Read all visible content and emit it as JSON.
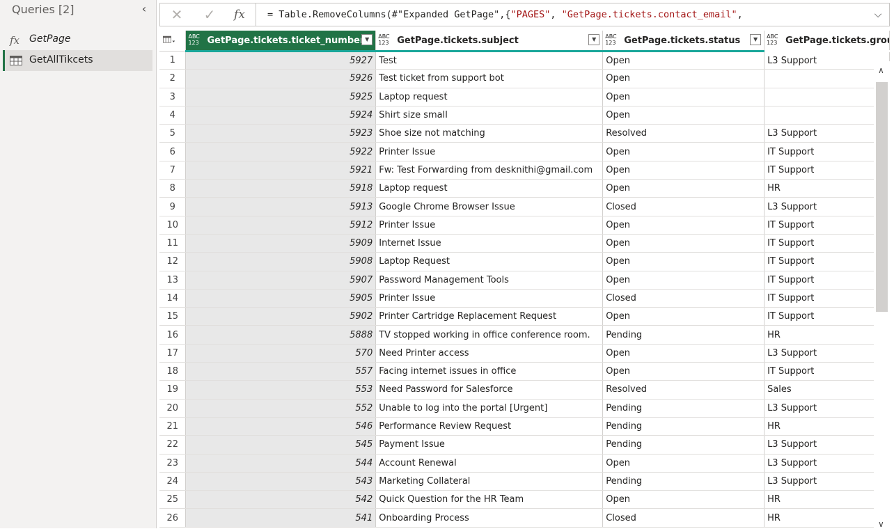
{
  "queries": {
    "title": "Queries [2]",
    "items": [
      {
        "label": "GetPage",
        "icon": "function-icon"
      },
      {
        "label": "GetAllTikcets",
        "icon": "table-icon"
      }
    ]
  },
  "formula_bar": {
    "prefix": "= Table.RemoveColumns(#\"Expanded GetPage\",{",
    "str1": "\"PAGES\"",
    "mid": ", ",
    "str2": "\"GetPage.tickets.contact_email\"",
    "suffix": ","
  },
  "columns": [
    {
      "label": "GetPage.tickets.ticket_number",
      "type": "ABC 123"
    },
    {
      "label": "GetPage.tickets.subject",
      "type": "ABC 123"
    },
    {
      "label": "GetPage.tickets.status",
      "type": "ABC 123"
    },
    {
      "label": "GetPage.tickets.group",
      "type": "ABC 123"
    }
  ],
  "rows": [
    [
      "1",
      "5927",
      "Test",
      "Open",
      "L3 Support"
    ],
    [
      "2",
      "5926",
      "Test ticket from support bot",
      "Open",
      ""
    ],
    [
      "3",
      "5925",
      "Laptop request",
      "Open",
      ""
    ],
    [
      "4",
      "5924",
      "Shirt size small",
      "Open",
      ""
    ],
    [
      "5",
      "5923",
      "Shoe size not matching",
      "Resolved",
      "L3 Support"
    ],
    [
      "6",
      "5922",
      "Printer Issue",
      "Open",
      "IT Support"
    ],
    [
      "7",
      "5921",
      "Fw: Test Forwarding from desknithi@gmail.com",
      "Open",
      "IT Support"
    ],
    [
      "8",
      "5918",
      "Laptop request",
      "Open",
      "HR"
    ],
    [
      "9",
      "5913",
      "Google Chrome Browser Issue",
      "Closed",
      "L3 Support"
    ],
    [
      "10",
      "5912",
      "Printer Issue",
      "Open",
      "IT Support"
    ],
    [
      "11",
      "5909",
      "Internet Issue",
      "Open",
      "IT Support"
    ],
    [
      "12",
      "5908",
      "Laptop Request",
      "Open",
      "IT Support"
    ],
    [
      "13",
      "5907",
      "Password Management Tools",
      "Open",
      "IT Support"
    ],
    [
      "14",
      "5905",
      "Printer Issue",
      "Closed",
      "IT Support"
    ],
    [
      "15",
      "5902",
      "Printer Cartridge Replacement Request",
      "Open",
      "IT Support"
    ],
    [
      "16",
      "5888",
      "TV stopped working in office conference room.",
      "Pending",
      "HR"
    ],
    [
      "17",
      "570",
      "Need Printer access",
      "Open",
      "L3 Support"
    ],
    [
      "18",
      "557",
      "Facing internet issues in office",
      "Open",
      "IT Support"
    ],
    [
      "19",
      "553",
      "Need Password for Salesforce",
      "Resolved",
      "Sales"
    ],
    [
      "20",
      "552",
      "Unable to log into the portal [Urgent]",
      "Pending",
      "L3 Support"
    ],
    [
      "21",
      "546",
      "Performance Review Request",
      "Pending",
      "HR"
    ],
    [
      "22",
      "545",
      "Payment Issue",
      "Pending",
      "L3 Support"
    ],
    [
      "23",
      "544",
      "Account Renewal",
      "Open",
      "L3 Support"
    ],
    [
      "24",
      "543",
      "Marketing Collateral",
      "Pending",
      "L3 Support"
    ],
    [
      "25",
      "542",
      "Quick Question for the HR Team",
      "Open",
      "HR"
    ],
    [
      "26",
      "541",
      "Onboarding Process",
      "Closed",
      "HR"
    ]
  ],
  "colors": {
    "accent": "#217346",
    "quality_bar": "#1aa79a",
    "string_literal": "#a31515"
  }
}
